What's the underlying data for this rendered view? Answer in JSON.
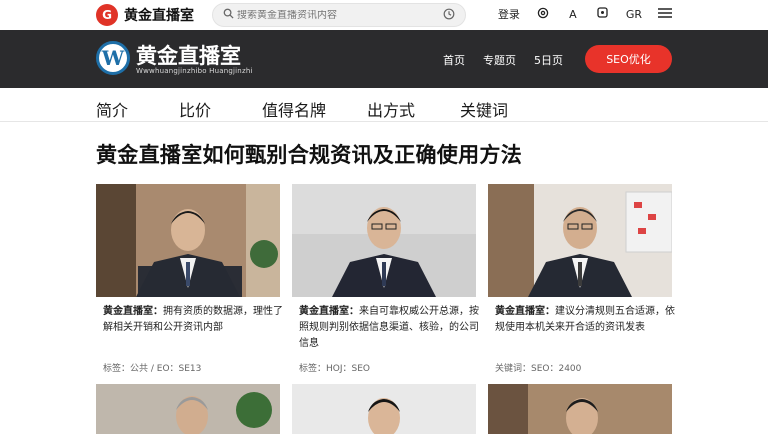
{
  "topbar": {
    "logo_badge": "G",
    "logo_text": "黄金直播室",
    "search_placeholder": "搜索黄金直播资讯内容",
    "icons": [
      "登录",
      "@",
      "A",
      "□",
      "GR",
      "menu"
    ]
  },
  "navbar": {
    "logo_letter": "W",
    "brand": "黄金直播室",
    "brand_sub": "Wwwhuangjinzhibo Huangjinzhi",
    "links": [
      "首页",
      "专题页",
      "5日页"
    ],
    "cta": "SEO优化"
  },
  "subnav": {
    "tabs": [
      "简介",
      "比价",
      "值得名牌",
      "出方式",
      "关键词"
    ]
  },
  "page": {
    "title": "黄金直播室如何甄别合规资讯及正确使用方法"
  },
  "cards": [
    {
      "label": "黄金直播室：",
      "text": "拥有资质的数据源，理性了解相关开销和公开资讯内部",
      "meta": "标签：公共 / EO：SE13"
    },
    {
      "label": "黄金直播室：",
      "text": "来自可靠权威公开总源，按照规则判别依据信息渠道、核验，的公司信息",
      "meta": "标签：HOJ：SEO"
    },
    {
      "label": "黄金直播室：",
      "text": "建议分清规则五合适源，依规使用本机关来开合适的资讯发表",
      "meta": "关键词：SEO：2400"
    }
  ],
  "colors": {
    "navbar_bg": "#2b2b2d",
    "accent": "#e8332a",
    "wp_blue": "#1e6fa8"
  }
}
